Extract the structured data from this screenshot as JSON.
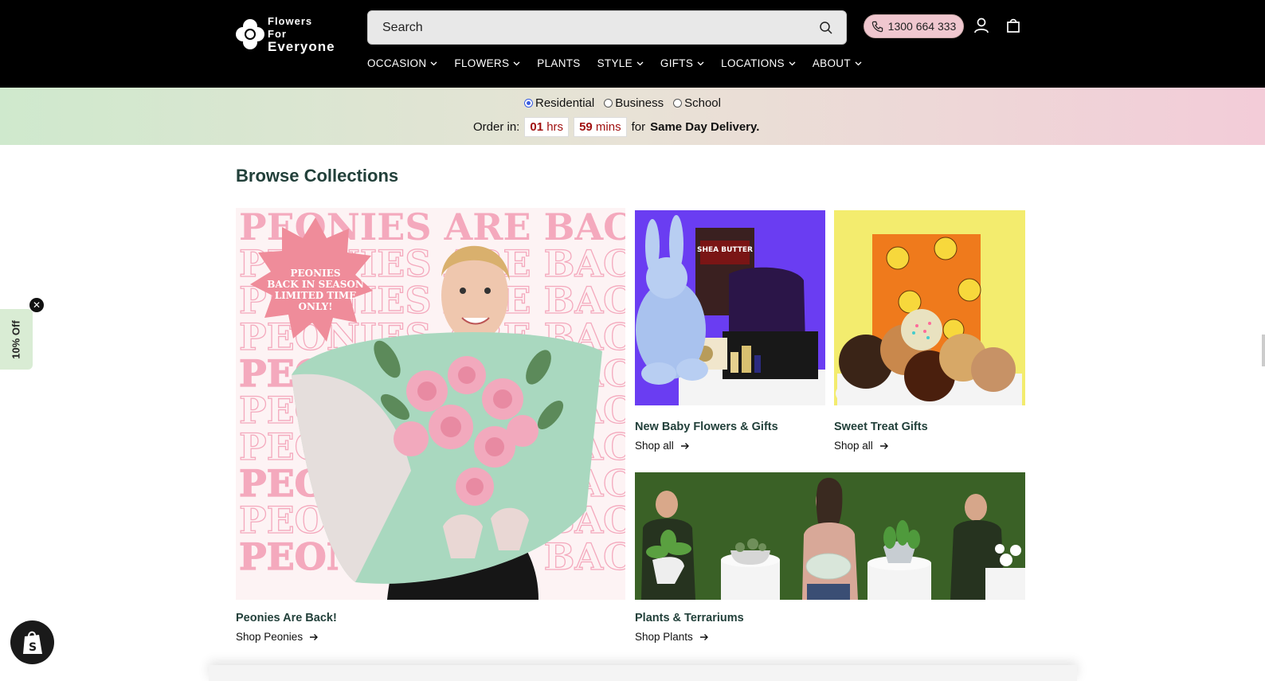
{
  "header": {
    "logo": {
      "line1": "Flowers",
      "line2": "For",
      "line3": "Everyone"
    },
    "search": {
      "placeholder": "Search"
    },
    "phone": "1300 664 333",
    "icons": [
      "search-icon",
      "phone-icon",
      "account-icon",
      "cart-icon"
    ]
  },
  "nav": {
    "items": [
      {
        "label": "OCCASION",
        "dropdown": true
      },
      {
        "label": "FLOWERS",
        "dropdown": true
      },
      {
        "label": "PLANTS",
        "dropdown": false
      },
      {
        "label": "STYLE",
        "dropdown": true
      },
      {
        "label": "GIFTS",
        "dropdown": true
      },
      {
        "label": "LOCATIONS",
        "dropdown": true
      },
      {
        "label": "ABOUT",
        "dropdown": true
      }
    ]
  },
  "banner": {
    "options": [
      {
        "label": "Residential",
        "selected": true
      },
      {
        "label": "Business",
        "selected": false
      },
      {
        "label": "School",
        "selected": false
      }
    ],
    "order_in": "Order in:",
    "hours": "01",
    "hours_unit": "hrs",
    "mins": "59",
    "mins_unit": "mins",
    "for_text": "for",
    "delivery": "Same Day Delivery."
  },
  "main": {
    "title": "Browse Collections",
    "collections": [
      {
        "title": "Peonies Are Back!",
        "link": "Shop Peonies"
      },
      {
        "title": "New Baby Flowers & Gifts",
        "link": "Shop all"
      },
      {
        "title": "Sweet Treat Gifts",
        "link": "Shop all"
      },
      {
        "title": "Plants & Terrariums",
        "link": "Shop Plants"
      }
    ],
    "peonies_banner": {
      "headline": "PEONIES ARE BACK",
      "badge": "PEONIES BACK IN SEASON LIMITED TIME ONLY!"
    },
    "baby_box": {
      "label": "SHEA BUTTER"
    }
  },
  "promo": {
    "label": "10% Off",
    "close": "✕"
  },
  "colors": {
    "header_bg": "#000000",
    "title": "#22403a",
    "accent_red": "#a01010"
  }
}
